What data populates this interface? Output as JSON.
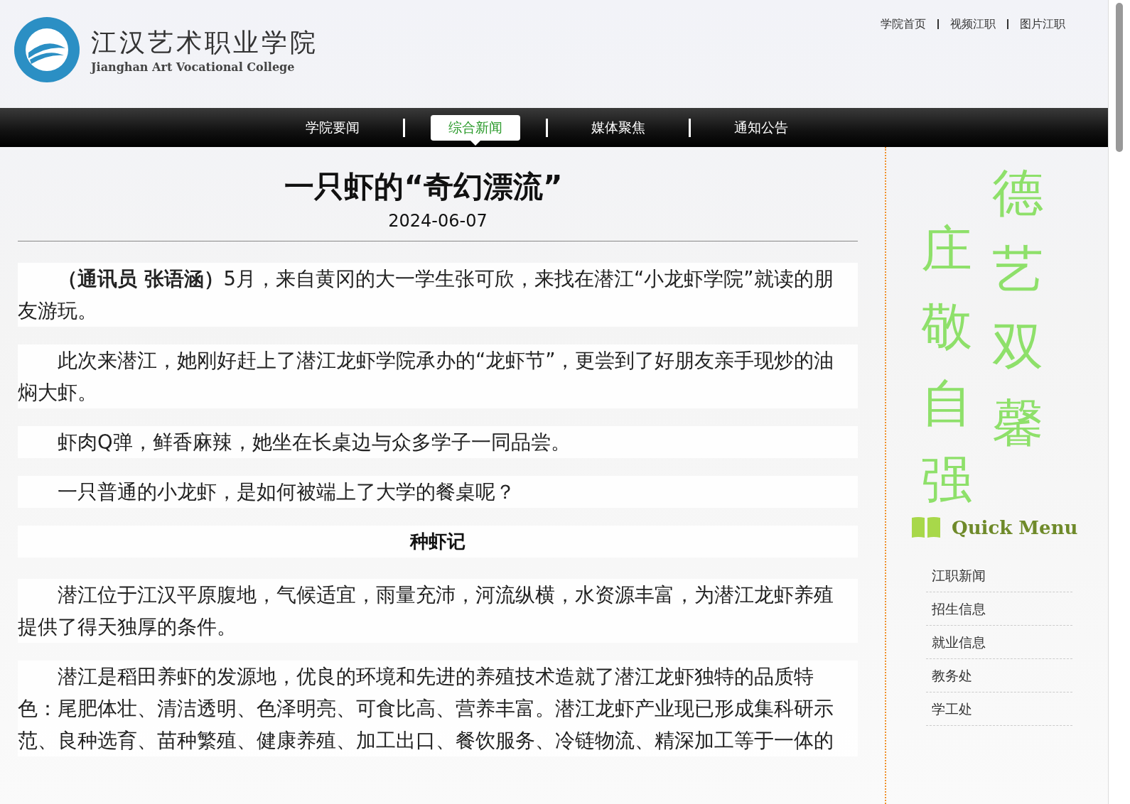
{
  "header": {
    "logo_title": "江汉艺术职业学院",
    "logo_subtitle": "Jianghan Art Vocational College",
    "top_links": [
      "学院首页",
      "视频江职",
      "图片江职"
    ]
  },
  "nav": [
    {
      "label": "学院要闻",
      "selected": false
    },
    {
      "label": "综合新闻",
      "selected": true
    },
    {
      "label": "媒体聚焦",
      "selected": false
    },
    {
      "label": "通知公告",
      "selected": false
    }
  ],
  "article": {
    "title": "一只虾的“奇幻漂流”",
    "date": "2024-06-07",
    "blocks": [
      {
        "kind": "paragraph",
        "text": "**（通讯员 张语涵）**5月，来自黄冈的大一学生张可欣，来找在潜江“小龙虾学院”就读的朋友游玩。"
      },
      {
        "kind": "paragraph",
        "text": "此次来潜江，她刚好赶上了潜江龙虾学院承办的“龙虾节”，更尝到了好朋友亲手现炒的油焖大虾。"
      },
      {
        "kind": "paragraph",
        "text": "虾肉Q弹，鲜香麻辣，她坐在长桌边与众多学子一同品尝。"
      },
      {
        "kind": "paragraph",
        "text": "一只普通的小龙虾，是如何被端上了大学的餐桌呢？"
      },
      {
        "kind": "heading",
        "text": "种虾记"
      },
      {
        "kind": "paragraph",
        "text": "潜江位于江汉平原腹地，气候适宜，雨量充沛，河流纵横，水资源丰富，为潜江龙虾养殖提供了得天独厚的条件。"
      },
      {
        "kind": "paragraph",
        "text": "潜江是稻田养虾的发源地，优良的环境和先进的养殖技术造就了潜江龙虾独特的品质特色：尾肥体壮、清洁透明、色泽明亮、可食比高、营养丰富。潜江龙虾产业现已形成集科研示范、良种选育、苗种繁殖、健康养殖、加工出口、餐饮服务、冷链物流、精深加工等于一体的"
      }
    ]
  },
  "sidebar": {
    "motto": [
      "德艺双馨",
      "庄敬自强"
    ],
    "menu_title": "Quick Menu",
    "menu": [
      "江职新闻",
      "招生信息",
      "就业信息",
      "教务处",
      "学工处"
    ]
  }
}
